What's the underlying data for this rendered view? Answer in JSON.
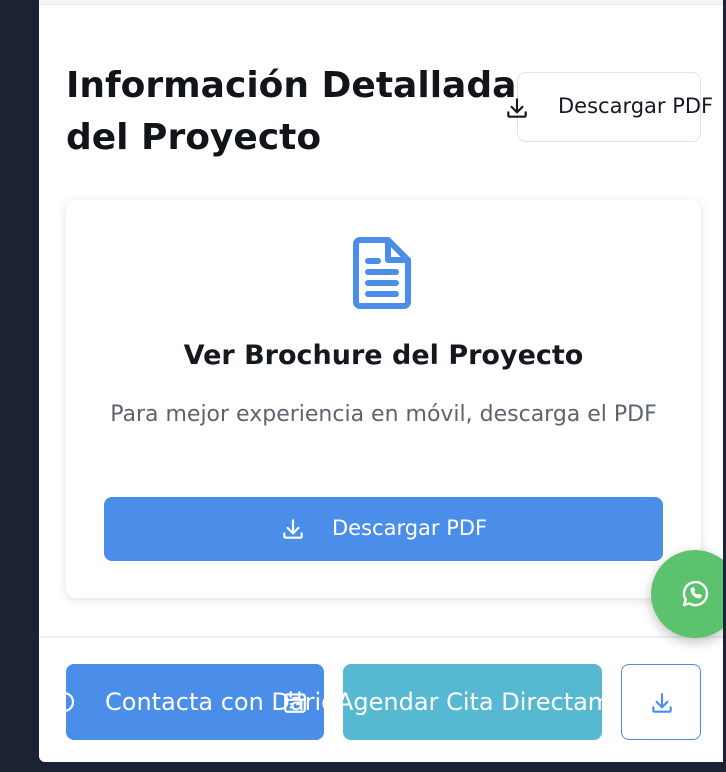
{
  "section": {
    "title": "Información Detallada del Proyecto",
    "top_download_label": "Descargar PDF"
  },
  "brochure_card": {
    "icon": "document-icon",
    "title": "Ver Brochure del Proyecto",
    "subtitle": "Para mejor experiencia en móvil, descarga el PDF",
    "download_label": "Descargar PDF"
  },
  "bottom_bar": {
    "contact_label": "Contacta con Dario",
    "schedule_label": "Agendar Cita Directamente",
    "download_icon": "download-icon"
  },
  "floating": {
    "whatsapp_icon": "whatsapp-icon"
  },
  "colors": {
    "primary": "#4a8eea",
    "secondary": "#57b8d2",
    "whatsapp": "#5cc26d",
    "background": "#1a2233"
  }
}
